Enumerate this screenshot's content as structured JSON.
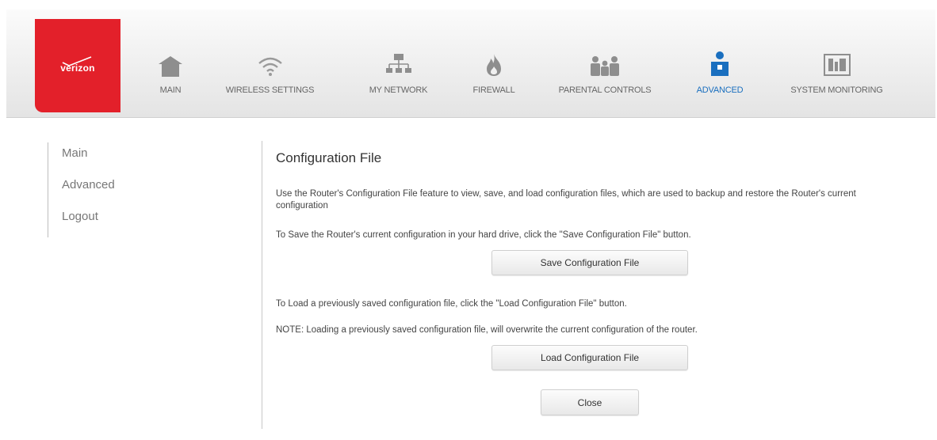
{
  "brand": {
    "logo_text": "verizon",
    "accent_color": "#e3202a",
    "active_color": "#1a6fbf"
  },
  "nav": {
    "items": [
      {
        "label": "MAIN",
        "icon": "home-icon"
      },
      {
        "label": "WIRELESS SETTINGS",
        "icon": "wifi-icon"
      },
      {
        "label": "MY NETWORK",
        "icon": "network-icon"
      },
      {
        "label": "FIREWALL",
        "icon": "flame-icon"
      },
      {
        "label": "PARENTAL CONTROLS",
        "icon": "family-icon"
      },
      {
        "label": "ADVANCED",
        "icon": "person-icon",
        "active": true
      },
      {
        "label": "SYSTEM MONITORING",
        "icon": "monitor-icon"
      }
    ]
  },
  "sidebar": {
    "items": [
      {
        "label": "Main"
      },
      {
        "label": "Advanced"
      },
      {
        "label": "Logout"
      }
    ]
  },
  "main": {
    "title": "Configuration File",
    "intro": "Use the Router's Configuration File feature to view, save, and load configuration files, which are used to backup and restore the Router's current configuration",
    "save_instructions": "To Save the Router's current configuration in your hard drive, click the \"Save Configuration File\" button.",
    "save_button": "Save Configuration File",
    "load_instructions": "To Load a previously saved configuration file, click the \"Load Configuration File\" button.",
    "note": "NOTE: Loading a previously saved configuration file, will overwrite the current configuration of the router.",
    "load_button": "Load Configuration File",
    "close_button": "Close"
  }
}
